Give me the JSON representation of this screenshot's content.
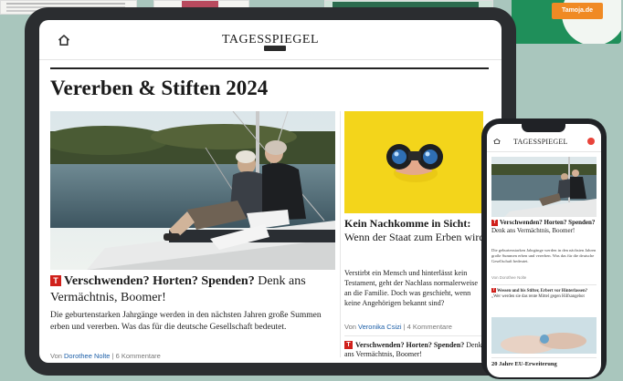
{
  "tablet": {
    "brand": "TAGESSPIEGEL",
    "section_title": "Vererben & Stiften 2024",
    "hero": {
      "headline_bold": "Verschwenden? Horten? Spenden?",
      "headline_rest": " Denk ans Vermächtnis, Boomer!",
      "lead": "Die geburtenstarken Jahrgänge werden in den nächsten Jahren große Summen erben und vererben. Was das für die deutsche Gesellschaft bedeutet.",
      "meta_prefix": "Von ",
      "author": "Dorothee Nolte",
      "meta_sep": " | ",
      "comments": "6 Kommentare"
    },
    "side": {
      "headline_bold": "Kein Nachkomme in Sicht:",
      "headline_rest": " Wenn der Staat zum Erben wird",
      "lead": "Verstirbt ein Mensch und hinterlässt kein Testament, geht der Nachlass normalerweise an die Familie. Doch was geschieht, wenn keine Angehörigen bekannt sind?",
      "meta_prefix": "Von ",
      "author": "Veronika Csizi",
      "meta_sep": " | ",
      "comments": "4 Kommentare",
      "more_bold": "Verschwenden? Horten? Spenden?",
      "more_rest": " Denk ans Vermächtnis, Boomer!"
    }
  },
  "phone": {
    "brand": "TAGESSPIEGEL",
    "headline_bold": "Verschwenden? Horten? Spenden?",
    "headline_rest": " Denk ans Vermächtnis, Boomer!",
    "lead": "Die geburtenstarken Jahrgänge werden in den nächsten Jahren große Summen erben und vererben. Was das für die deutsche Gesellschaft bedeutet.",
    "meta": "Von Dorothee Nolte",
    "head2_bold": "Wessen und bis Stifter, Erbert vor Hinterlassen?",
    "head2_rest": " „Wer werden sie das rente Mittel gegen Hilfsangebot",
    "footer": "20 Jahre EU-Erweiterung"
  },
  "ad": {
    "cta": "Tamoja.de"
  },
  "colors": {
    "background": "#a9c6bd",
    "device": "#2b2d30",
    "accent_red": "#d0201b",
    "author_blue": "#1d5fa8",
    "ad_green": "#1f8f5a",
    "ad_orange": "#f08a24",
    "yellow": "#f3d51b"
  },
  "icons": [
    "home-icon",
    "tagesspiegel-t-icon",
    "binoculars-illustration"
  ]
}
